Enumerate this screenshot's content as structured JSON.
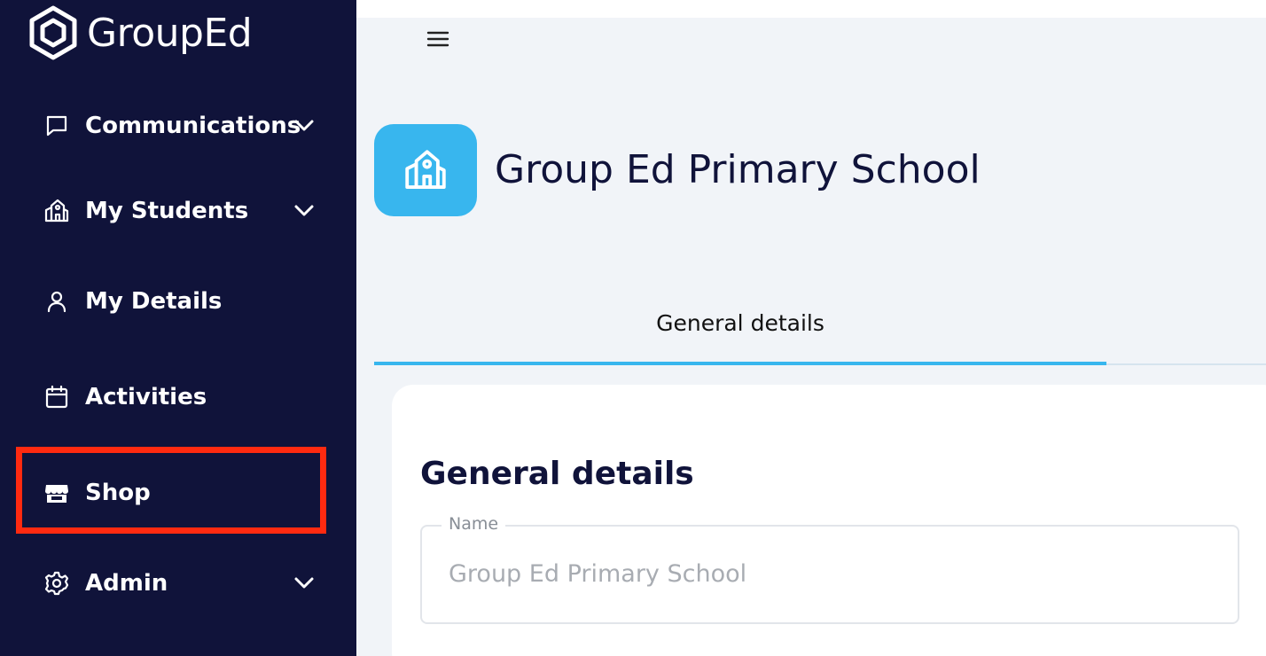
{
  "brand": {
    "name": "GroupEd"
  },
  "sidebar": {
    "items": [
      {
        "label": "Communications",
        "icon": "chat-icon",
        "expandable": true
      },
      {
        "label": "My Students",
        "icon": "school-building-icon",
        "expandable": true
      },
      {
        "label": "My Details",
        "icon": "user-icon",
        "expandable": false
      },
      {
        "label": "Activities",
        "icon": "calendar-icon",
        "expandable": false
      },
      {
        "label": "Shop",
        "icon": "store-icon",
        "expandable": false,
        "highlighted": true
      },
      {
        "label": "Admin",
        "icon": "gear-icon",
        "expandable": true
      }
    ]
  },
  "header": {
    "school_name": "Group Ed Primary School",
    "menu_icon": "hamburger-icon"
  },
  "tabs": [
    {
      "label": "General details",
      "active": true
    }
  ],
  "form": {
    "section_title": "General details",
    "name_field": {
      "label": "Name",
      "value": "Group Ed Primary School"
    }
  },
  "colors": {
    "sidebar_bg": "#10133a",
    "accent": "#38b6ee",
    "highlight_border": "#ff2a10",
    "page_bg": "#f1f4f8"
  }
}
